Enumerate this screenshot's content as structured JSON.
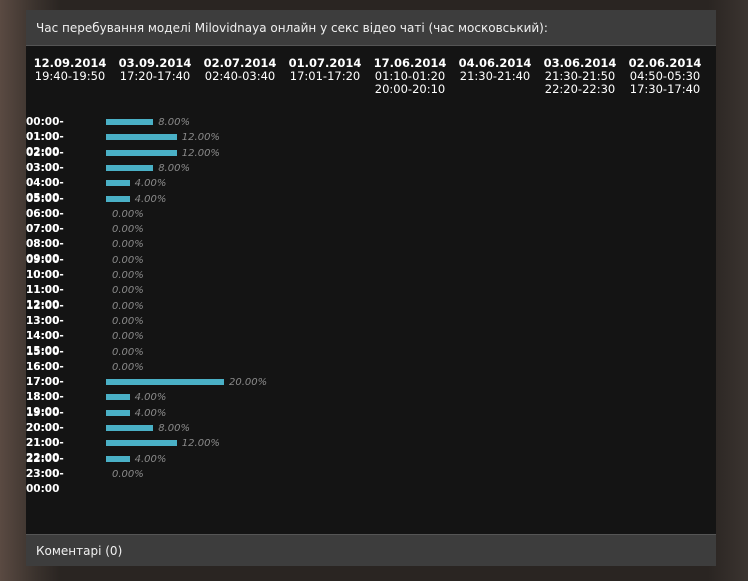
{
  "header": {
    "title": "Час перебування моделі Milovidnaya онлайн у секс відео чаті (час московський):"
  },
  "sessions": [
    {
      "date": "12.09.2014",
      "times": [
        "19:40-19:50"
      ]
    },
    {
      "date": "03.09.2014",
      "times": [
        "17:20-17:40"
      ]
    },
    {
      "date": "02.07.2014",
      "times": [
        "02:40-03:40"
      ]
    },
    {
      "date": "01.07.2014",
      "times": [
        "17:01-17:20"
      ]
    },
    {
      "date": "17.06.2014",
      "times": [
        "01:10-01:20",
        "20:00-20:10"
      ]
    },
    {
      "date": "04.06.2014",
      "times": [
        "21:30-21:40"
      ]
    },
    {
      "date": "03.06.2014",
      "times": [
        "21:30-21:50",
        "22:20-22:30"
      ]
    },
    {
      "date": "02.06.2014",
      "times": [
        "04:50-05:30",
        "17:30-17:40"
      ]
    }
  ],
  "chart_data": {
    "type": "bar",
    "orientation": "horizontal",
    "categories": [
      "00:00-01:00",
      "01:00-02:00",
      "02:00-03:00",
      "03:00-04:00",
      "04:00-05:00",
      "05:00-06:00",
      "06:00-07:00",
      "07:00-08:00",
      "08:00-09:00",
      "09:00-10:00",
      "10:00-11:00",
      "11:00-12:00",
      "12:00-13:00",
      "13:00-14:00",
      "14:00-15:00",
      "15:00-16:00",
      "16:00-17:00",
      "17:00-18:00",
      "18:00-19:00",
      "19:00-20:00",
      "20:00-21:00",
      "21:00-22:00",
      "22:00-23:00",
      "23:00-00:00"
    ],
    "values": [
      8,
      12,
      12,
      8,
      4,
      4,
      0,
      0,
      0,
      0,
      0,
      0,
      0,
      0,
      0,
      0,
      0,
      20,
      4,
      4,
      8,
      12,
      4,
      0
    ],
    "labels": [
      "8.00%",
      "12.00%",
      "12.00%",
      "8.00%",
      "4.00%",
      "4.00%",
      "0.00%",
      "0.00%",
      "0.00%",
      "0.00%",
      "0.00%",
      "0.00%",
      "0.00%",
      "0.00%",
      "0.00%",
      "0.00%",
      "0.00%",
      "20.00%",
      "4.00%",
      "4.00%",
      "8.00%",
      "12.00%",
      "4.00%",
      "0.00%"
    ],
    "bar_color": "#4ab0c6",
    "xlim": [
      0,
      100
    ]
  },
  "footer": {
    "comments_label": "Коментарі (0)"
  }
}
